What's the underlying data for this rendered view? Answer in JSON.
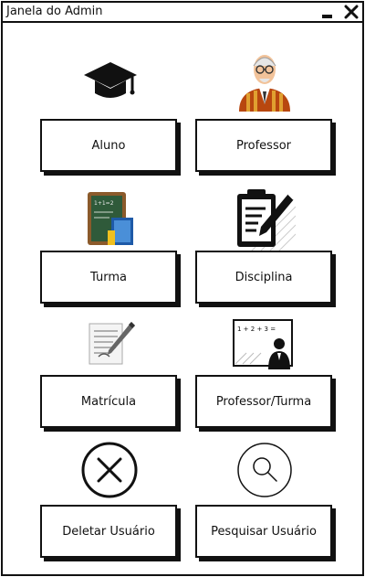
{
  "window": {
    "title": "Janela do Admin"
  },
  "buttons": {
    "aluno": "Aluno",
    "professor": "Professor",
    "turma": "Turma",
    "disciplina": "Disciplina",
    "matricula": "Matrícula",
    "professor_turma": "Professor/Turma",
    "deletar_usuario": "Deletar Usuário",
    "pesquisar_usuario": "Pesquisar Usuário"
  },
  "icons": {
    "aluno": "graduation-cap-icon",
    "professor": "professor-avatar-icon",
    "turma": "chalkboard-books-icon",
    "disciplina": "clipboard-pencil-icon",
    "matricula": "form-pen-icon",
    "professor_turma": "teacher-at-board-icon",
    "deletar_usuario": "delete-circle-x-icon",
    "pesquisar_usuario": "search-magnifier-icon"
  },
  "chalkboard_text": "1 + 2 + 3 ="
}
